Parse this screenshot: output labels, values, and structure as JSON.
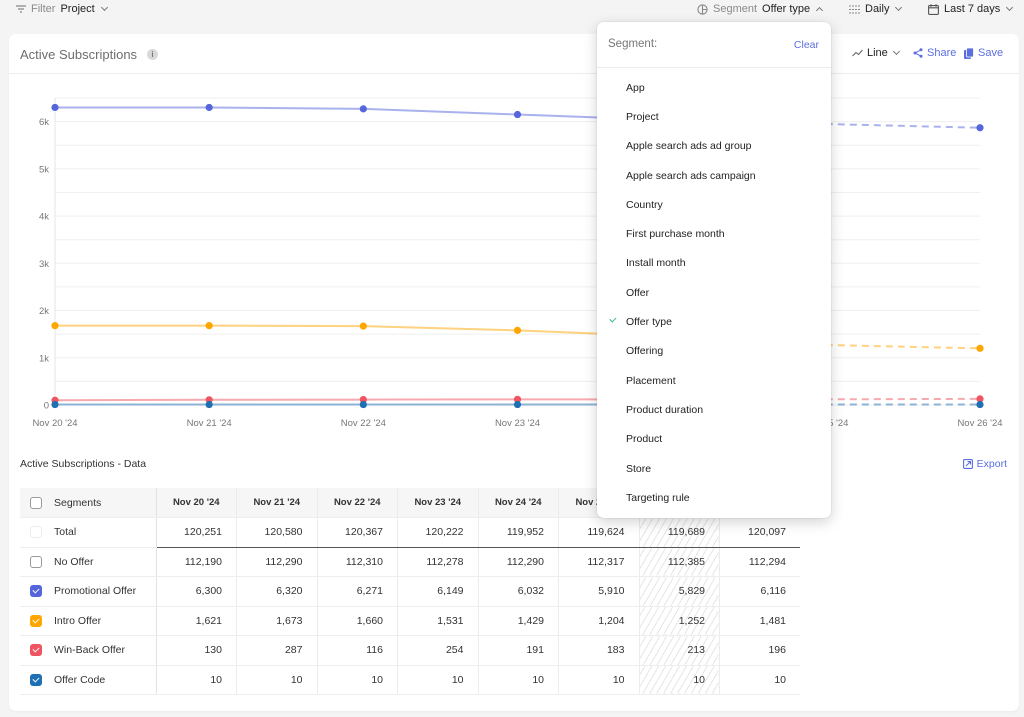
{
  "topbar": {
    "filter_label": "Filter",
    "filter_value": "Project",
    "segment_label": "Segment",
    "segment_value": "Offer type",
    "interval_value": "Daily",
    "range_value": "Last 7 days"
  },
  "card": {
    "title": "Active Subscriptions",
    "chart_type_label": "Line",
    "share_label": "Share",
    "save_label": "Save"
  },
  "colors": {
    "promotional": "#5566dd",
    "intro": "#ffa600",
    "winback": "#ee5560",
    "offercode": "#1f6fb5",
    "accent": "#5b6ee1",
    "check": "#2eb88a"
  },
  "chart_data": {
    "type": "line",
    "title": "Active Subscriptions",
    "xlabel": "",
    "ylabel": "",
    "x": [
      "Nov 20 '24",
      "Nov 21 '24",
      "Nov 22 '24",
      "Nov 23 '24",
      "Nov 24 '24",
      "Nov 25 '24",
      "Nov 26 '24"
    ],
    "yticks": [
      "0",
      "1k",
      "2k",
      "3k",
      "4k",
      "5k",
      "6k"
    ],
    "ylim": [
      0,
      6500
    ],
    "grid": true,
    "incomplete_from_index": 5,
    "series": [
      {
        "name": "Promotional Offer",
        "color_key": "promotional",
        "values": [
          6300,
          6320,
          6271,
          6149,
          6032,
          5910,
          5829,
          6116
        ]
      },
      {
        "name": "Intro Offer",
        "color_key": "intro",
        "values": [
          1621,
          1673,
          1660,
          1531,
          1429,
          1204,
          1252,
          1481
        ]
      },
      {
        "name": "Win-Back Offer",
        "color_key": "winback",
        "values": [
          130,
          287,
          116,
          254,
          191,
          183,
          213,
          196
        ]
      },
      {
        "name": "Offer Code",
        "color_key": "offercode",
        "values": [
          10,
          10,
          10,
          10,
          10,
          10,
          10,
          10
        ]
      }
    ],
    "plotted_points": [
      {
        "series": "Promotional Offer",
        "values": [
          6300,
          6300,
          6270,
          6150,
          6030,
          5950,
          5870
        ]
      },
      {
        "series": "Intro Offer",
        "values": [
          1680,
          1680,
          1670,
          1580,
          1450,
          1270,
          1200
        ]
      },
      {
        "series": "Win-Back Offer",
        "values": [
          100,
          110,
          115,
          120,
          120,
          120,
          130
        ]
      },
      {
        "series": "Offer Code",
        "values": [
          10,
          10,
          10,
          10,
          10,
          10,
          10
        ]
      }
    ]
  },
  "data_section": {
    "title": "Active Subscriptions - Data",
    "export_label": "Export",
    "columns": [
      "Segments",
      "Nov 20 '24",
      "Nov 21 '24",
      "Nov 22 '24",
      "Nov 23 '24",
      "Nov 24 '24",
      "Nov 25 '24",
      "",
      ""
    ],
    "rows": [
      {
        "label": "Total",
        "checked": false,
        "faint": true,
        "color_key": "",
        "values": [
          "120,251",
          "120,580",
          "120,367",
          "120,222",
          "119,952",
          "119,624",
          "119,689",
          "120,097"
        ]
      },
      {
        "label": "No Offer",
        "checked": false,
        "faint": false,
        "color_key": "",
        "values": [
          "112,190",
          "112,290",
          "112,310",
          "112,278",
          "112,290",
          "112,317",
          "112,385",
          "112,294"
        ]
      },
      {
        "label": "Promotional Offer",
        "checked": true,
        "faint": false,
        "color_key": "promotional",
        "values": [
          "6,300",
          "6,320",
          "6,271",
          "6,149",
          "6,032",
          "5,910",
          "5,829",
          "6,116"
        ]
      },
      {
        "label": "Intro Offer",
        "checked": true,
        "faint": false,
        "color_key": "intro",
        "values": [
          "1,621",
          "1,673",
          "1,660",
          "1,531",
          "1,429",
          "1,204",
          "1,252",
          "1,481"
        ]
      },
      {
        "label": "Win-Back Offer",
        "checked": true,
        "faint": false,
        "color_key": "winback",
        "values": [
          "130",
          "287",
          "116",
          "254",
          "191",
          "183",
          "213",
          "196"
        ]
      },
      {
        "label": "Offer Code",
        "checked": true,
        "faint": false,
        "color_key": "offercode",
        "values": [
          "10",
          "10",
          "10",
          "10",
          "10",
          "10",
          "10",
          "10"
        ]
      }
    ]
  },
  "dropdown": {
    "label": "Segment:",
    "clear_label": "Clear",
    "selected": "Offer type",
    "options": [
      "App",
      "Project",
      "Apple search ads ad group",
      "Apple search ads campaign",
      "Country",
      "First purchase month",
      "Install month",
      "Offer",
      "Offer type",
      "Offering",
      "Placement",
      "Product duration",
      "Product",
      "Store",
      "Targeting rule"
    ]
  }
}
